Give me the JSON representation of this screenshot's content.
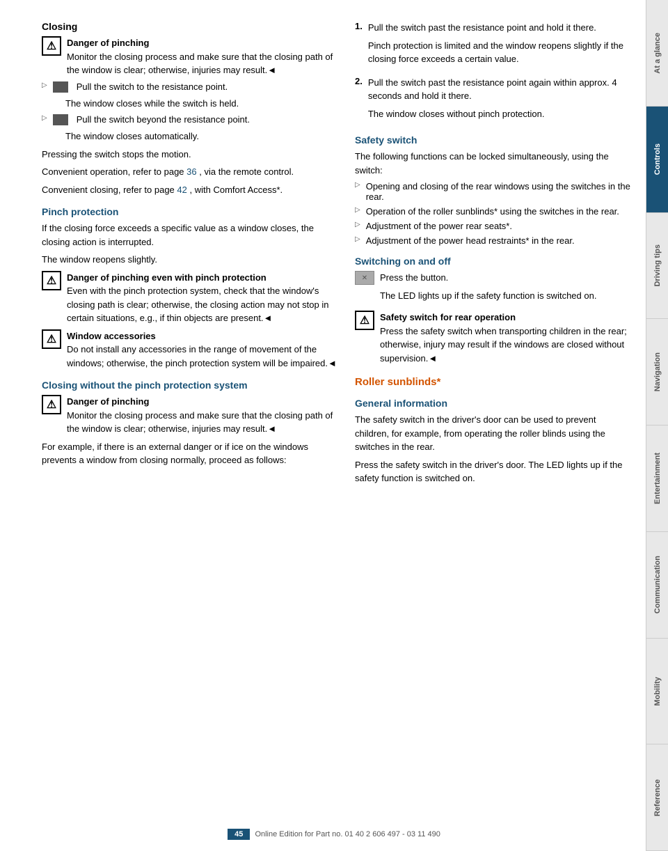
{
  "page": {
    "number": "45",
    "footer_text": "Online Edition for Part no. 01 40 2 606 497 - 03 11 490"
  },
  "sidebar": {
    "items": [
      {
        "label": "At a glance",
        "active": false
      },
      {
        "label": "Controls",
        "active": true
      },
      {
        "label": "Driving tips",
        "active": false
      },
      {
        "label": "Navigation",
        "active": false
      },
      {
        "label": "Entertainment",
        "active": false
      },
      {
        "label": "Communication",
        "active": false
      },
      {
        "label": "Mobility",
        "active": false
      },
      {
        "label": "Reference",
        "active": false
      }
    ]
  },
  "left": {
    "closing_title": "Closing",
    "warning1_title": "Danger of pinching",
    "warning1_text": "Monitor the closing process and make sure that the closing path of the window is clear; otherwise, injuries may result.◄",
    "arrow1_icon": "switch",
    "arrow1_text": "Pull the switch to the resistance point.",
    "arrow1_sub": "The window closes while the switch is held.",
    "arrow2_icon": "switch",
    "arrow2_text": "Pull the switch beyond the resistance point.",
    "arrow2_sub": "The window closes automatically.",
    "pressing_text": "Pressing the switch stops the motion.",
    "convenient1_text": "Convenient operation, refer to page",
    "convenient1_link": "36",
    "convenient1_rest": ", via the remote control.",
    "convenient2_text": "Convenient closing, refer to page",
    "convenient2_link": "42",
    "convenient2_rest": ", with Comfort Access*.",
    "pinch_title": "Pinch protection",
    "pinch_text1": "If the closing force exceeds a specific value as a window closes, the closing action is interrupted.",
    "pinch_text2": "The window reopens slightly.",
    "warning2_title": "Danger of pinching even with pinch protection",
    "warning2_text": "Even with the pinch protection system, check that the window's closing path is clear; otherwise, the closing action may not stop in certain situations, e.g., if thin objects are present.◄",
    "warning3_title": "Window accessories",
    "warning3_text": "Do not install any accessories in the range of movement of the windows; otherwise, the pinch protection system will be impaired.◄",
    "closing_no_pinch_title": "Closing without the pinch protection system",
    "warning4_title": "Danger of pinching",
    "warning4_text": "Monitor the closing process and make sure that the closing path of the window is clear; otherwise, injuries may result.◄",
    "example_text": "For example, if there is an external danger or if ice on the windows prevents a window from closing normally, proceed as follows:"
  },
  "right": {
    "step1_num": "1.",
    "step1_text1": "Pull the switch past the resistance point and hold it there.",
    "step1_text2": "Pinch protection is limited and the window reopens slightly if the closing force exceeds a certain value.",
    "step2_num": "2.",
    "step2_text1": "Pull the switch past the resistance point again within approx. 4 seconds and hold it there.",
    "step2_text2": "The window closes without pinch protection.",
    "safety_switch_title": "Safety switch",
    "safety_switch_text1": "The following functions can be locked simultaneously, using the switch:",
    "bullet1": "Opening and closing of the rear windows using the switches in the rear.",
    "bullet2": "Operation of the roller sunblinds* using the switches in the rear.",
    "bullet3": "Adjustment of the power rear seats*.",
    "bullet4": "Adjustment of the power head restraints* in the rear.",
    "switching_title": "Switching on and off",
    "safety_icon_label": "safety switch button icon",
    "press_text": "Press the button.",
    "led_text": "The LED lights up if the safety function is switched on.",
    "warning5_title": "Safety switch for rear operation",
    "warning5_text": "Press the safety switch when transporting children in the rear; otherwise, injury may result if the windows are closed without supervision.◄",
    "roller_title": "Roller sunblinds*",
    "general_info_title": "General information",
    "general_text1": "The safety switch in the driver's door can be used to prevent children, for example, from operating the roller blinds using the switches in the rear.",
    "general_text2": "Press the safety switch in the driver's door. The LED lights up if the safety function is switched on."
  }
}
